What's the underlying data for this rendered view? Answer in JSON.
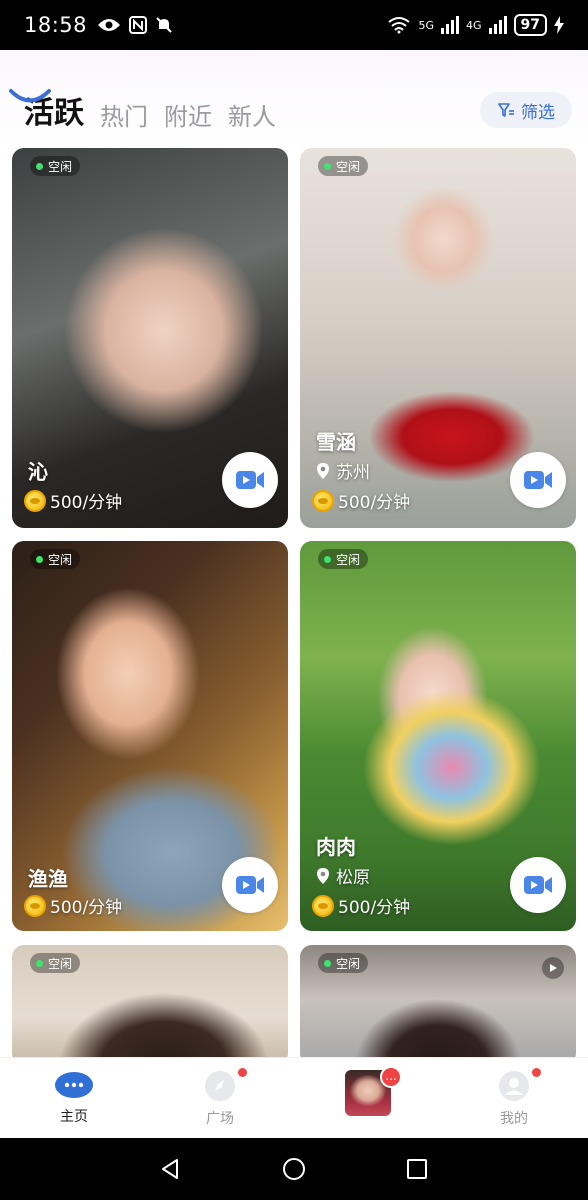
{
  "status_bar": {
    "time": "18:58",
    "net1": "5G",
    "net2": "4G",
    "battery": "97"
  },
  "tabs": [
    {
      "label": "活跃",
      "active": true
    },
    {
      "label": "热门",
      "active": false
    },
    {
      "label": "附近",
      "active": false
    },
    {
      "label": "新人",
      "active": false
    }
  ],
  "filter": {
    "label": "筛选"
  },
  "cards": [
    {
      "status": "空闲",
      "name": "沁",
      "location": "",
      "price": "500/分钟"
    },
    {
      "status": "空闲",
      "name": "雪涵",
      "location": "苏州",
      "price": "500/分钟"
    },
    {
      "status": "空闲",
      "name": "渔渔",
      "location": "",
      "price": "500/分钟"
    },
    {
      "status": "空闲",
      "name": "肉肉",
      "location": "松原",
      "price": "500/分钟"
    },
    {
      "status": "空闲",
      "name": "",
      "location": "",
      "price": ""
    },
    {
      "status": "空闲",
      "name": "",
      "location": "",
      "price": ""
    }
  ],
  "bottom_nav": {
    "home": "主页",
    "plaza": "广场",
    "me": "我的",
    "badge": "..."
  },
  "colors": {
    "accent": "#3a6fd8",
    "online": "#3ee36f",
    "badge": "#f04444"
  }
}
